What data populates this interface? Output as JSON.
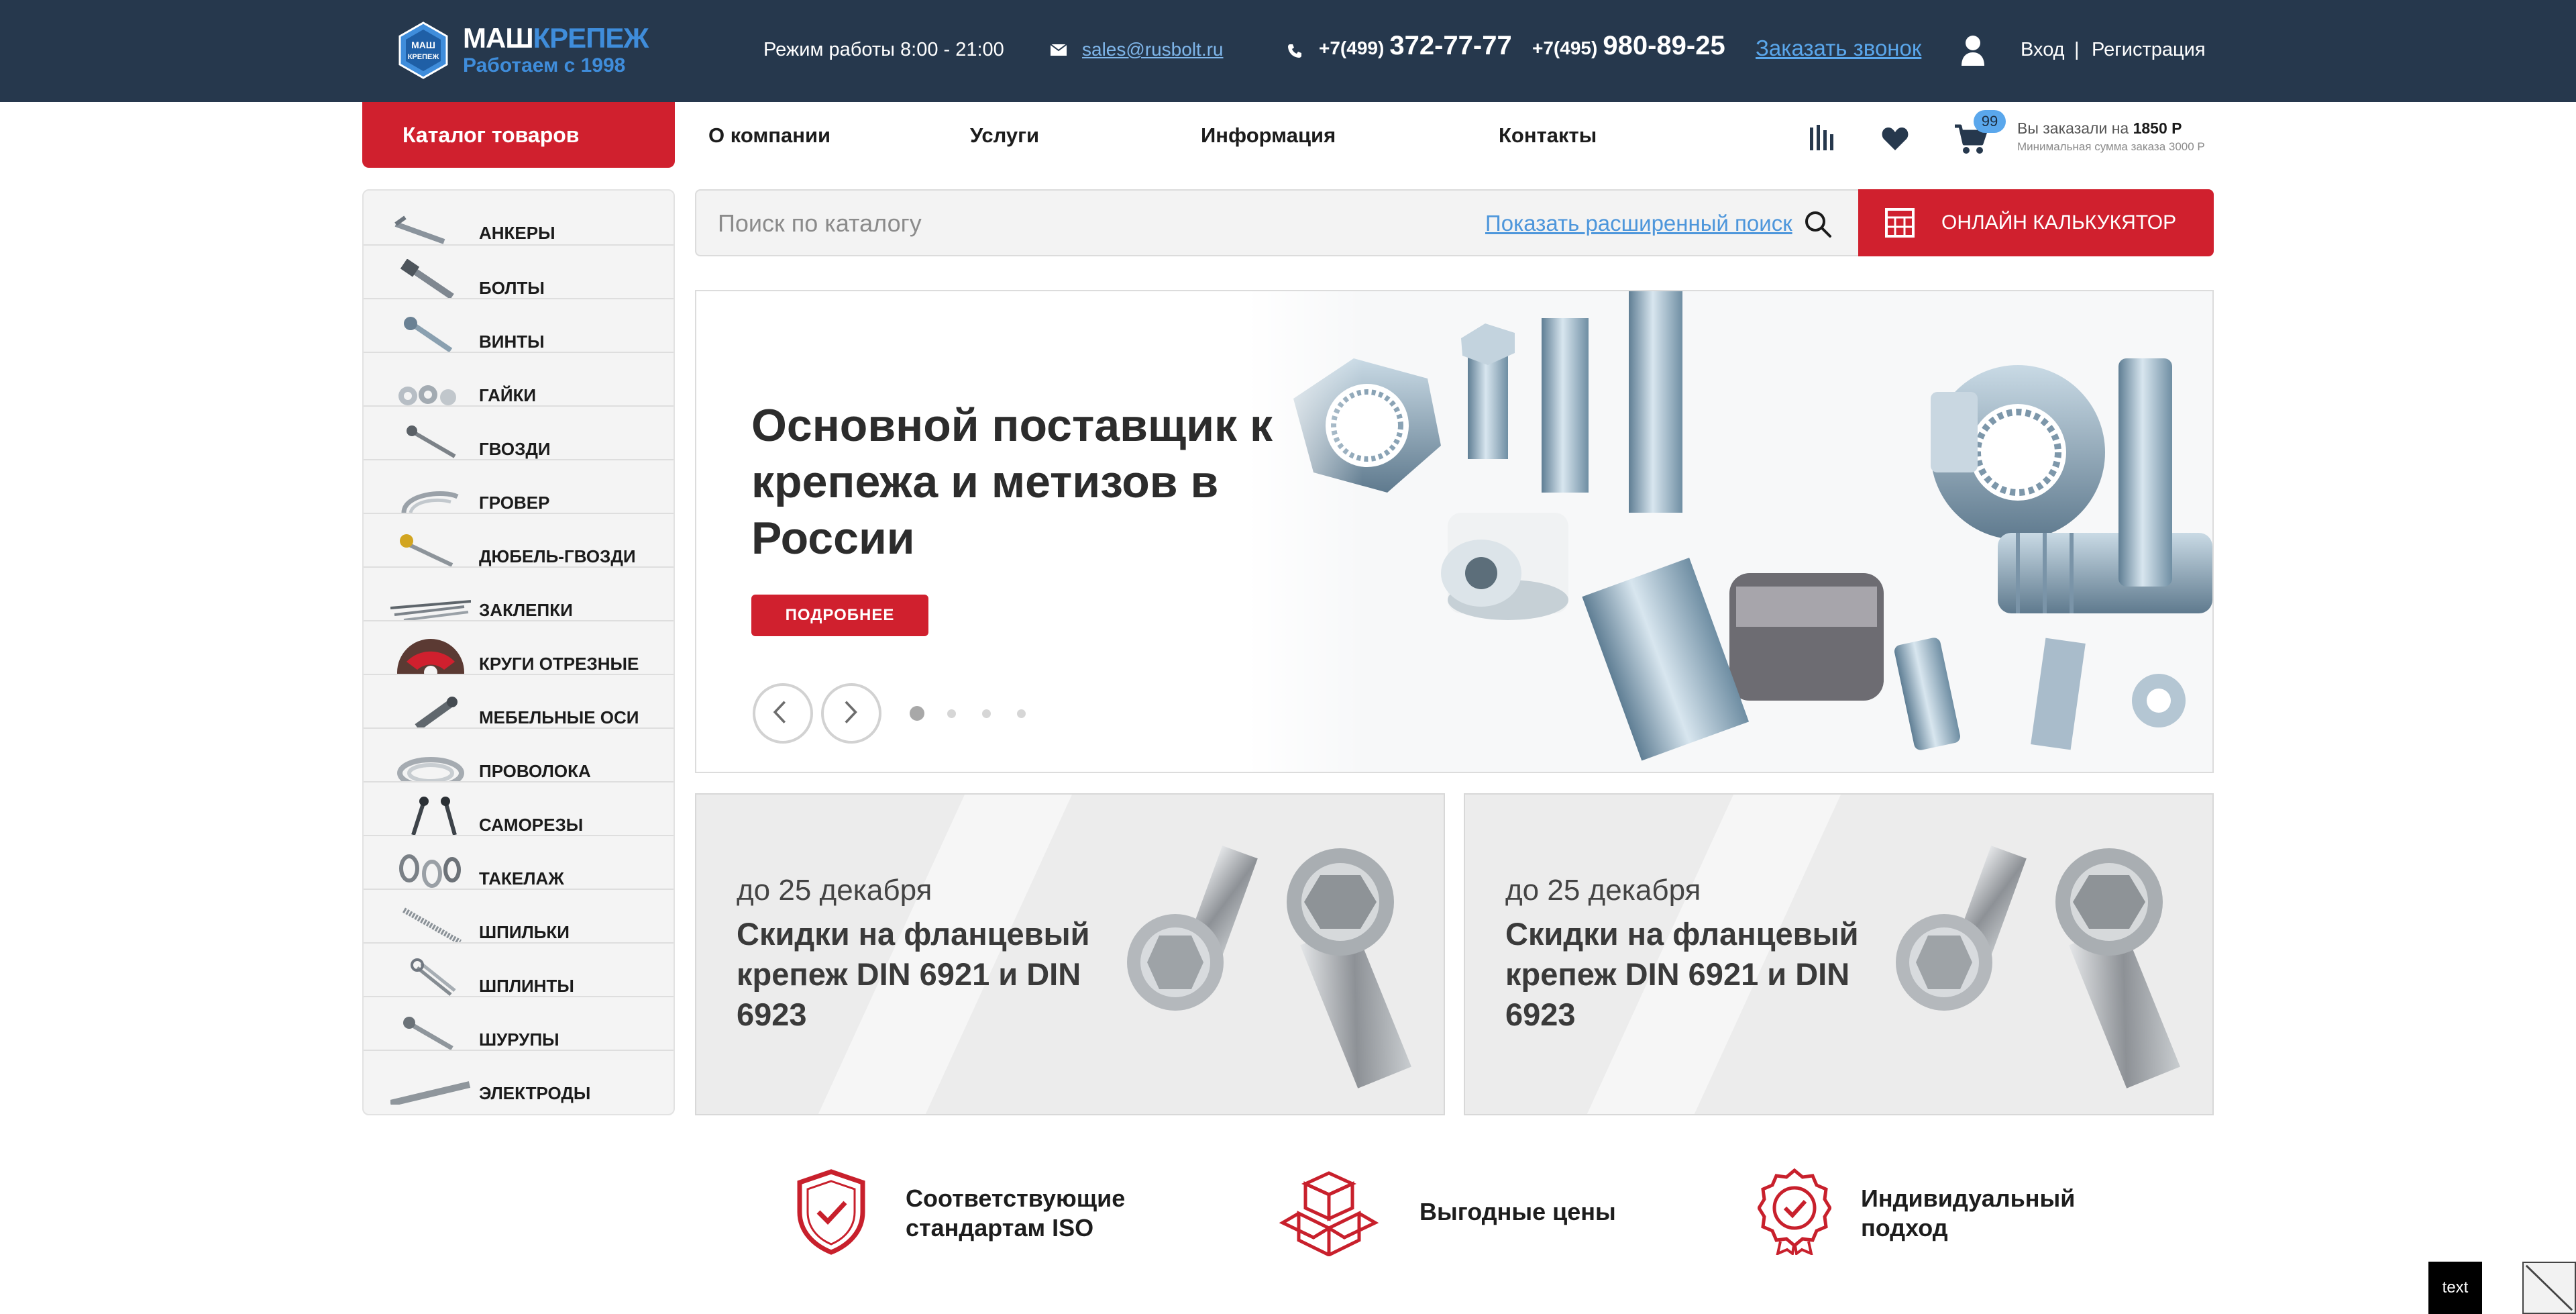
{
  "header": {
    "logo": {
      "brand_part1": "МАШ",
      "brand_part2": "КРЕПЕЖ",
      "tagline": "Работаем с 1998",
      "badge_text": "МАШ КРЕПЕЖ"
    },
    "hours": "Режим работы 8:00 - 21:00",
    "email": "sales@rusbolt.ru",
    "phones": [
      {
        "code": "+7(499)",
        "number": "372-77-77"
      },
      {
        "code": "+7(495)",
        "number": "980-89-25"
      }
    ],
    "callback_label": "Заказать звонок",
    "login_label": "Вход",
    "separator": "|",
    "register_label": "Регистрация"
  },
  "nav": {
    "catalog_label": "Каталог товаров",
    "items": [
      "О компании",
      "Услуги",
      "Информация",
      "Контакты"
    ],
    "cart_count": "99",
    "cart_summary_prefix": "Вы заказали на",
    "cart_summary_amount": "1850 Р",
    "cart_min_order": "Минимальная сумма заказа 3000 Р"
  },
  "sidebar": {
    "items": [
      "АНКЕРЫ",
      "БОЛТЫ",
      "ВИНТЫ",
      "ГАЙКИ",
      "ГВОЗДИ",
      "ГРОВЕР",
      "ДЮБЕЛЬ-ГВОЗДИ",
      "ЗАКЛЕПКИ",
      "КРУГИ ОТРЕЗНЫЕ",
      "МЕБЕЛЬНЫЕ ОСИ",
      "ПРОВОЛОКА",
      "САМОРЕЗЫ",
      "ТАКЕЛАЖ",
      "ШПИЛЬКИ",
      "ШПЛИНТЫ",
      "ШУРУПЫ",
      "ЭЛЕКТРОДЫ"
    ]
  },
  "search": {
    "placeholder": "Поиск по каталогу",
    "advanced_label": "Показать расширенный поиск",
    "calculator_label": "ОНЛАЙН КАЛЬКУКЯТОР"
  },
  "hero": {
    "title": "Основной поставщик к крепежа и метизов в России",
    "button_label": "ПОДРОБНЕЕ",
    "slide_count": 4,
    "active_slide": 1
  },
  "promos": [
    {
      "date": "до 25 декабря",
      "title": "Скидки на фланцевый крепеж DIN 6921 и DIN 6923"
    },
    {
      "date": "до 25 декабря",
      "title": "Скидки на фланцевый крепеж DIN 6921 и DIN 6923"
    }
  ],
  "features": [
    {
      "icon": "shield-check-icon",
      "text": "Соответствующие стандартам ISO"
    },
    {
      "icon": "box-icon",
      "text": "Выгодные цены"
    },
    {
      "icon": "award-badge-icon",
      "text": "Индивидуальный подход"
    }
  ],
  "corner": {
    "text_label": "text"
  },
  "colors": {
    "topbar": "#26384d",
    "accent_red": "#d0202e",
    "accent_blue": "#3f8ddb",
    "link_blue": "#5aa7ec"
  }
}
